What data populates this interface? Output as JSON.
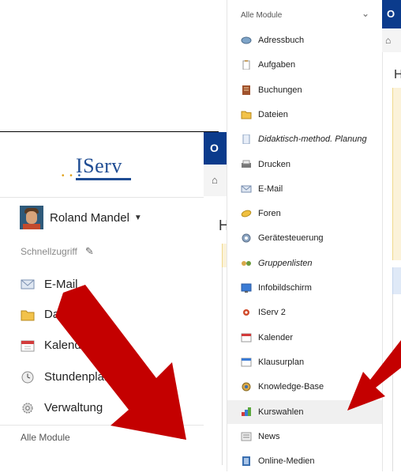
{
  "left_panel": {
    "logo_text": "IServ",
    "user": {
      "name": "Roland Mandel"
    },
    "quick_access_label": "Schnellzugriff",
    "nav_items": [
      {
        "label": "E-Mail",
        "icon": "envelope-icon"
      },
      {
        "label": "Dateien",
        "icon": "folder-icon"
      },
      {
        "label": "Kalender",
        "icon": "calendar-icon"
      },
      {
        "label": "Stundenplan",
        "icon": "clock-icon"
      },
      {
        "label": "Verwaltung",
        "icon": "gear-icon"
      }
    ],
    "all_modules_label": "Alle Module"
  },
  "header_fragments": {
    "blue_letter": "O",
    "home_glyph": "⌂",
    "heading_letter": "H"
  },
  "dropdown": {
    "header": "Alle Module",
    "items": [
      {
        "label": "Adressbuch",
        "icon": "address-book-icon"
      },
      {
        "label": "Aufgaben",
        "icon": "clipboard-icon"
      },
      {
        "label": "Buchungen",
        "icon": "ledger-icon"
      },
      {
        "label": "Dateien",
        "icon": "folder-icon"
      },
      {
        "label": "Didaktisch-method. Planung",
        "icon": "document-icon",
        "italic": true
      },
      {
        "label": "Drucken",
        "icon": "printer-icon"
      },
      {
        "label": "E-Mail",
        "icon": "envelope-icon"
      },
      {
        "label": "Foren",
        "icon": "forum-icon"
      },
      {
        "label": "Gerätesteuerung",
        "icon": "device-control-icon"
      },
      {
        "label": "Gruppenlisten",
        "icon": "group-icon",
        "italic": true
      },
      {
        "label": "Infobildschirm",
        "icon": "info-screen-icon"
      },
      {
        "label": "IServ 2",
        "icon": "iserv-icon"
      },
      {
        "label": "Kalender",
        "icon": "calendar-icon"
      },
      {
        "label": "Klausurplan",
        "icon": "exam-plan-icon"
      },
      {
        "label": "Knowledge-Base",
        "icon": "knowledge-icon"
      },
      {
        "label": "Kurswahlen",
        "icon": "course-choice-icon",
        "active": true
      },
      {
        "label": "News",
        "icon": "news-icon"
      },
      {
        "label": "Online-Medien",
        "icon": "media-icon"
      }
    ]
  },
  "colors": {
    "header_blue": "#0b3b8c",
    "arrow_red": "#c40000"
  }
}
